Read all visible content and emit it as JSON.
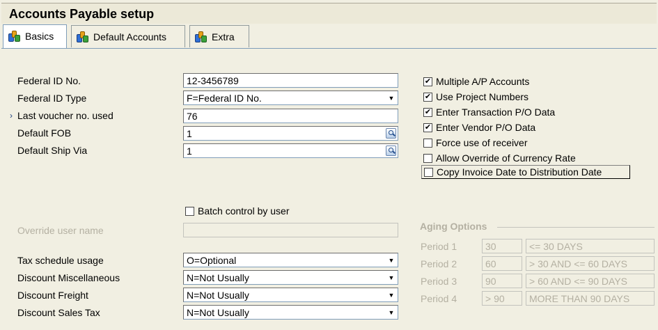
{
  "window": {
    "title": "Accounts Payable setup"
  },
  "tabs": [
    {
      "label": "Basics",
      "icon": "chart-icon"
    },
    {
      "label": "Default Accounts",
      "icon": "chart-icon"
    },
    {
      "label": "Extra",
      "icon": "chart-icon"
    }
  ],
  "fields": {
    "federal_id_no": {
      "label": "Federal ID No.",
      "value": "12-3456789"
    },
    "federal_id_type": {
      "label": "Federal ID Type",
      "value": "F=Federal ID No."
    },
    "last_voucher": {
      "label": "Last voucher no. used",
      "value": "76",
      "marker": "›"
    },
    "default_fob": {
      "label": "Default FOB",
      "value": "1"
    },
    "default_ship_via": {
      "label": "Default Ship Via",
      "value": "1"
    },
    "override_user_name": {
      "label": "Override user name",
      "value": ""
    },
    "tax_schedule_usage": {
      "label": "Tax schedule usage",
      "value": "O=Optional"
    },
    "discount_misc": {
      "label": "Discount Miscellaneous",
      "value": "N=Not Usually"
    },
    "discount_freight": {
      "label": "Discount Freight",
      "value": "N=Not Usually"
    },
    "discount_sales_tax": {
      "label": "Discount Sales Tax",
      "value": "N=Not Usually"
    }
  },
  "batch_control": {
    "label": "Batch control by user",
    "checked": false
  },
  "options": [
    {
      "label": "Multiple A/P Accounts",
      "checked": true
    },
    {
      "label": "Use Project Numbers",
      "checked": true
    },
    {
      "label": "Enter Transaction P/O Data",
      "checked": true
    },
    {
      "label": "Enter Vendor P/O Data",
      "checked": true
    },
    {
      "label": "Force use of receiver",
      "checked": false
    },
    {
      "label": "Allow Override of Currency Rate",
      "checked": false
    },
    {
      "label": "Copy Invoice Date to Distribution Date",
      "checked": false
    }
  ],
  "aging": {
    "title": "Aging Options",
    "periods": [
      {
        "label": "Period 1",
        "days": "30",
        "description": "<= 30 DAYS"
      },
      {
        "label": "Period 2",
        "days": "60",
        "description": "> 30 AND <= 60 DAYS"
      },
      {
        "label": "Period 3",
        "days": "90",
        "description": "> 60 AND <= 90 DAYS"
      },
      {
        "label": "Period 4",
        "days": "> 90",
        "description": "MORE THAN 90 DAYS"
      }
    ]
  },
  "glyphs": {
    "check": "✔",
    "dropdown": "▼"
  }
}
